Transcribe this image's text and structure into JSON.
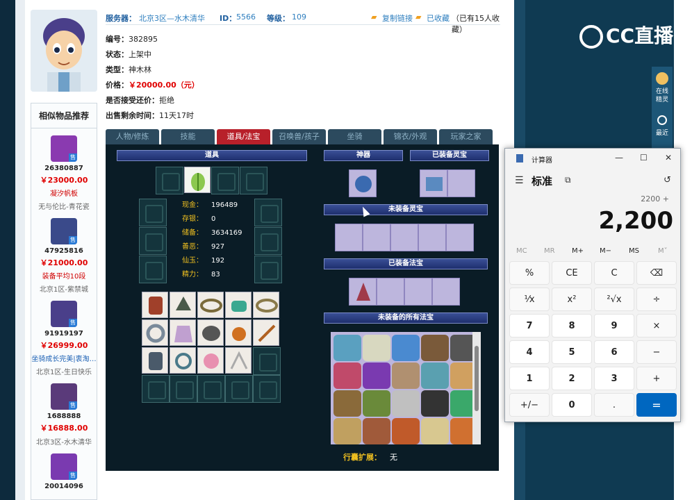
{
  "header": {
    "server_label": "服务器：",
    "server_value": "北京3区—水木清华",
    "id_label": "ID：",
    "id_value": "5566",
    "level_label": "等级：",
    "level_value": "109",
    "copy_link": "复制链接",
    "favorited": "已收藏",
    "fav_count": "（已有15人收藏）"
  },
  "fields": [
    {
      "label": "编号：",
      "value": "382895"
    },
    {
      "label": "状态：",
      "value": "上架中"
    },
    {
      "label": "类型：",
      "value": "神木林"
    },
    {
      "label": "价格：",
      "value": "￥20000.00（元）"
    },
    {
      "label": "是否接受还价：",
      "value": "拒绝"
    },
    {
      "label": "出售剩余时间：",
      "value": "11天17时"
    }
  ],
  "tabs": [
    "人物/修炼",
    "技能",
    "道具/法宝",
    "召唤兽/孩子",
    "坐骑",
    "锦衣/外观",
    "玩家之家"
  ],
  "active_tab": 2,
  "game": {
    "items_title": "道具",
    "shenqi_title": "神器",
    "equipped_lingbao_title": "已装备灵宝",
    "unequipped_lingbao_title": "未装备灵宝",
    "equipped_fabao_title": "已装备法宝",
    "all_fabao_title": "未装备的所有法宝",
    "stats": [
      {
        "k": "现金：",
        "v": "196489"
      },
      {
        "k": "存银：",
        "v": "0"
      },
      {
        "k": "储备：",
        "v": "3634169"
      },
      {
        "k": "善恶：",
        "v": "927"
      },
      {
        "k": "仙玉：",
        "v": "192"
      },
      {
        "k": "精力：",
        "v": "83"
      }
    ],
    "expand_label": "行囊扩展：",
    "expand_value": "无"
  },
  "sidebar": {
    "title": "相似物品推荐",
    "items": [
      {
        "id": "26380887",
        "price": "￥23000.00",
        "tag": "凝汐帆板",
        "server": "无与伦比-青花瓷",
        "sale": "售"
      },
      {
        "id": "47925816",
        "price": "￥21000.00",
        "tag": "装备平均10段",
        "server": "北京1区-紫禁城",
        "sale": "售"
      },
      {
        "id": "91919197",
        "price": "￥26999.00",
        "tag": "坐骑成长完美|衷淘…",
        "server": "北京1区-生日快乐",
        "sale": "售"
      },
      {
        "id": "1688888",
        "price": "￥16888.00",
        "tag": "",
        "server": "北京3区-水木清华",
        "sale": "售"
      },
      {
        "id": "20014096",
        "price": "",
        "tag": "",
        "server": "",
        "sale": "售"
      }
    ]
  },
  "calculator": {
    "title": "计算器",
    "mode": "标准",
    "expression": "2200 +",
    "display": "2,200",
    "memory": [
      "MC",
      "MR",
      "M+",
      "M−",
      "MS",
      "M˅"
    ],
    "keys": [
      [
        "%",
        "CE",
        "C",
        "⌫"
      ],
      [
        "¹⁄x",
        "x²",
        "²√x",
        "÷"
      ],
      [
        "7",
        "8",
        "9",
        "×"
      ],
      [
        "4",
        "5",
        "6",
        "−"
      ],
      [
        "1",
        "2",
        "3",
        "+"
      ],
      [
        "+/−",
        "0",
        ".",
        "="
      ]
    ]
  },
  "overlay": {
    "brand": "CC直播",
    "side_tab_1": "在线精灵",
    "side_tab_2": "最近"
  },
  "colors": {
    "accent_red": "#b8202a",
    "price_red": "#e00000",
    "calc_equals": "#0067c0"
  }
}
